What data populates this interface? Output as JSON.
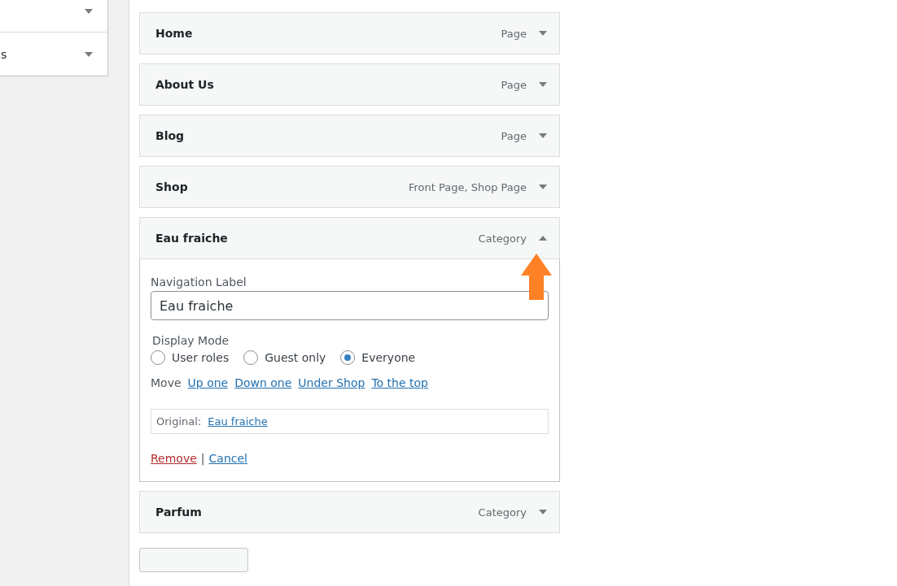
{
  "sidebar": {
    "items": [
      {
        "expanded": false
      },
      {
        "label": "s",
        "expanded": false
      }
    ]
  },
  "menu_items": [
    {
      "title": "Home",
      "type": "Page",
      "expanded": false
    },
    {
      "title": "About Us",
      "type": "Page",
      "expanded": false
    },
    {
      "title": "Blog",
      "type": "Page",
      "expanded": false
    },
    {
      "title": "Shop",
      "type": "Front Page, Shop Page",
      "expanded": false
    },
    {
      "title": "Eau fraiche",
      "type": "Category",
      "expanded": true,
      "settings": {
        "nav_label": "Navigation Label",
        "nav_value": "Eau fraiche",
        "display_mode": "Display Mode",
        "options": [
          {
            "label": "User roles",
            "selected": false
          },
          {
            "label": "Guest only",
            "selected": false
          },
          {
            "label": "Everyone",
            "selected": true
          }
        ],
        "move_label": "Move",
        "move_links": [
          "Up one",
          "Down one",
          "Under Shop",
          "To the top"
        ],
        "original_label": "Original:",
        "original_link": "Eau fraiche",
        "remove": "Remove",
        "separator": "|",
        "cancel": "Cancel"
      }
    },
    {
      "title": "Parfum",
      "type": "Category",
      "expanded": false
    }
  ]
}
